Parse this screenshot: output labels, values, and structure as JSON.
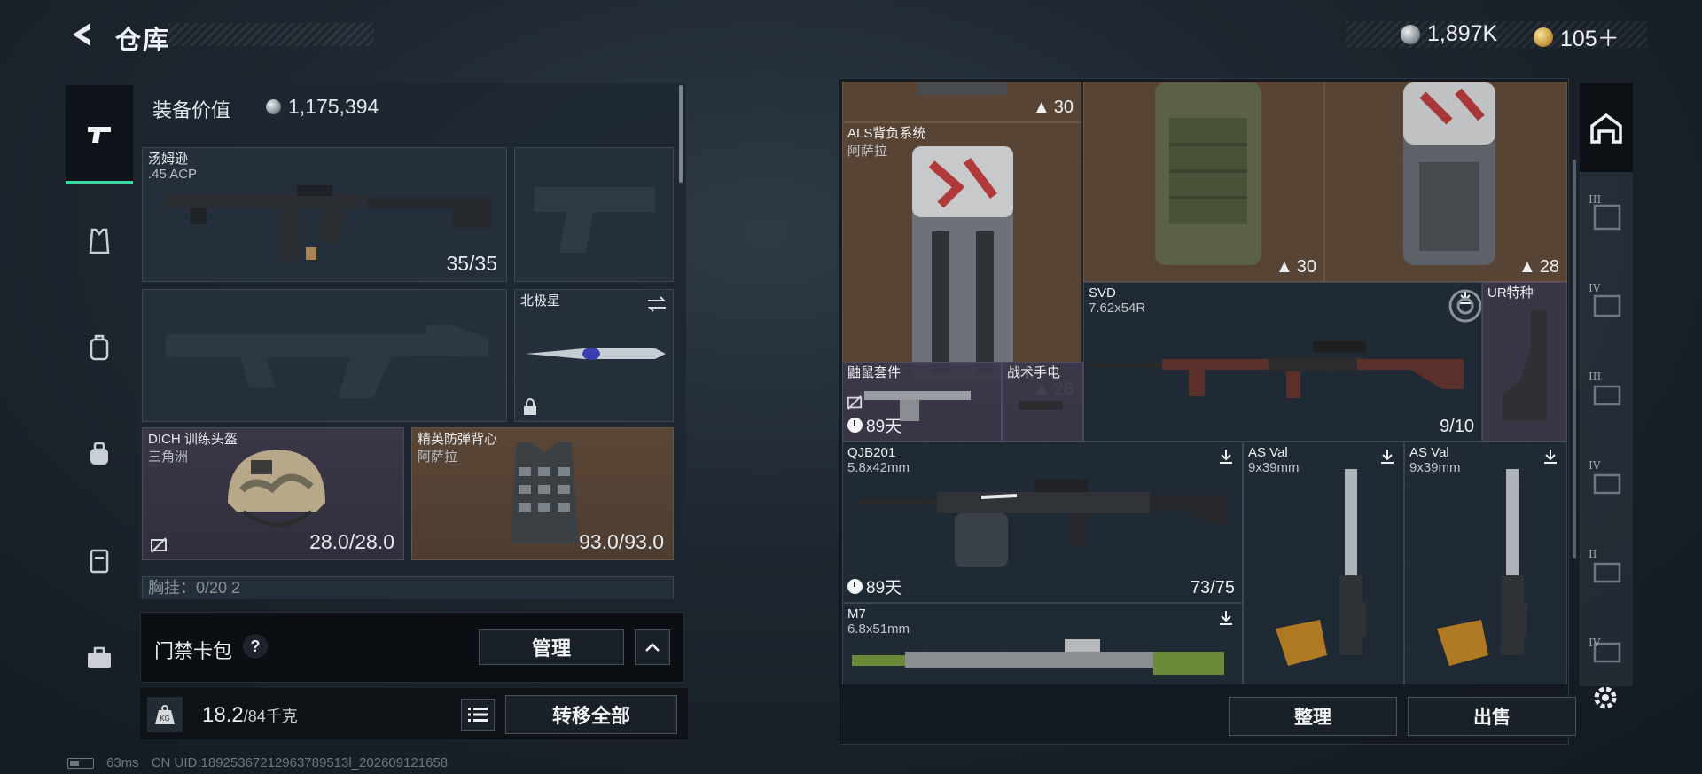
{
  "header": {
    "title": "仓库",
    "currency_silver": "1,897K",
    "currency_gold": "105＋"
  },
  "left_rail": {
    "items": [
      "pistol-icon",
      "vest-icon",
      "backpack-icon",
      "pouch-icon",
      "case-icon",
      "toolbox-icon"
    ],
    "active_index": 0
  },
  "equipment": {
    "value_label": "装备价值",
    "value": "1,175,394",
    "primary_weapon": {
      "name": "汤姆逊",
      "caliber": ".45 ACP",
      "ammo": "35/35"
    },
    "melee": {
      "name": "北极星"
    },
    "helmet": {
      "name": "DICH 训练头盔",
      "source": "三角洲",
      "durability": "28.0/28.0"
    },
    "armor": {
      "name": "精英防弹背心",
      "source": "阿萨拉",
      "durability": "93.0/93.0"
    },
    "chest_rig_partial": "胸挂：0/20 2"
  },
  "card_bar": {
    "label": "门禁卡包",
    "help": "?",
    "manage_label": "管理",
    "collapse_glyph": "^"
  },
  "weight": {
    "value": "18.2",
    "max_unit": "/84千克",
    "transfer_label": "转移全部"
  },
  "storage": {
    "items": [
      {
        "id": "top-left",
        "count": "30"
      },
      {
        "id": "als",
        "name": "ALS背负系统",
        "source": "阿萨拉",
        "count": "28"
      },
      {
        "id": "green-pack",
        "count": "30"
      },
      {
        "id": "gray-pack",
        "count": "28"
      },
      {
        "id": "svd",
        "name": "SVD",
        "caliber": "7.62x54R",
        "count": "9/10"
      },
      {
        "id": "ur",
        "name": "UR特种"
      },
      {
        "id": "gopher",
        "name": "鼬鼠套件",
        "days": "89天"
      },
      {
        "id": "flashlight",
        "name": "战术手电"
      },
      {
        "id": "qjb",
        "name": "QJB201",
        "caliber": "5.8x42mm",
        "days": "89天",
        "count": "73/75"
      },
      {
        "id": "asval1",
        "name": "AS Val",
        "caliber": "9x39mm"
      },
      {
        "id": "asval2",
        "name": "AS Val",
        "caliber": "9x39mm"
      },
      {
        "id": "m7",
        "name": "M7",
        "caliber": "6.8x51mm"
      }
    ],
    "sort_label": "整理",
    "sell_label": "出售"
  },
  "right_rail": {
    "tabs": [
      "III",
      "IV",
      "III",
      "IV",
      "II",
      "IV"
    ]
  },
  "footer": {
    "ping": "63ms",
    "uid": "CN UID:18925367212963789513l_202609121658"
  }
}
